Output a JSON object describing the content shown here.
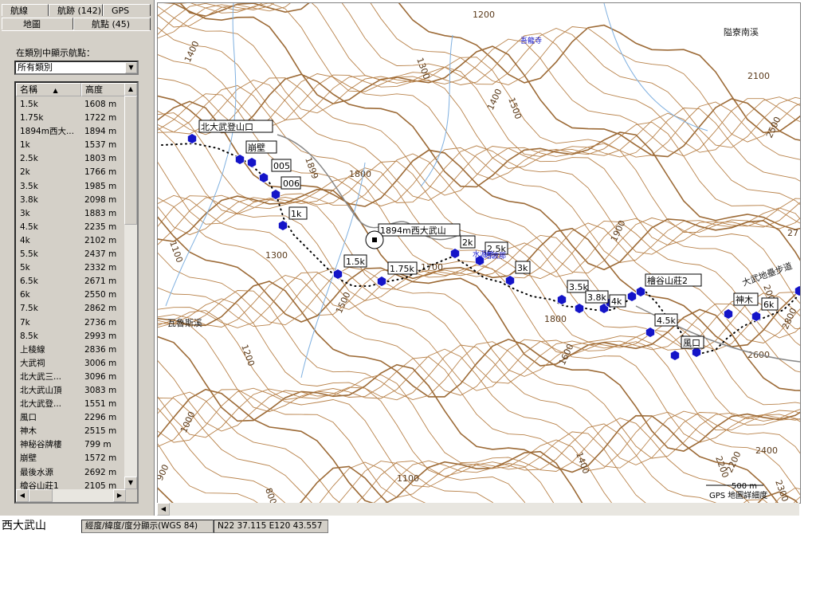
{
  "tabs_top": [
    "航線",
    "航跡 (142)",
    "GPS"
  ],
  "tabs_bottom": [
    "地圖",
    "航點 (45)"
  ],
  "filter": {
    "label": "在類別中顯示航點：",
    "selected": "所有類別"
  },
  "list": {
    "columns": [
      "名稱",
      "高度"
    ],
    "rows": [
      {
        "name": "1.5k",
        "alt": "1608 m"
      },
      {
        "name": "1.75k",
        "alt": "1722 m"
      },
      {
        "name": "1894m西大...",
        "alt": "1894 m"
      },
      {
        "name": "1k",
        "alt": "1537 m"
      },
      {
        "name": "2.5k",
        "alt": "1803 m"
      },
      {
        "name": "2k",
        "alt": "1766 m"
      },
      {
        "name": "3.5k",
        "alt": "1985 m"
      },
      {
        "name": "3.8k",
        "alt": "2098 m"
      },
      {
        "name": "3k",
        "alt": "1883 m"
      },
      {
        "name": "4.5k",
        "alt": "2235 m"
      },
      {
        "name": "4k",
        "alt": "2102 m"
      },
      {
        "name": "5.5k",
        "alt": "2437 m"
      },
      {
        "name": "5k",
        "alt": "2332 m"
      },
      {
        "name": "6.5k",
        "alt": "2671 m"
      },
      {
        "name": "6k",
        "alt": "2550 m"
      },
      {
        "name": "7.5k",
        "alt": "2862 m"
      },
      {
        "name": "7k",
        "alt": "2736 m"
      },
      {
        "name": "8.5k",
        "alt": "2993 m"
      },
      {
        "name": "上稜線",
        "alt": "2836 m"
      },
      {
        "name": "大武祠",
        "alt": "3006 m"
      },
      {
        "name": "北大武三...",
        "alt": "3096 m"
      },
      {
        "name": "北大武山頂",
        "alt": "3083 m"
      },
      {
        "name": "北大武登...",
        "alt": "1551 m"
      },
      {
        "name": "風口",
        "alt": "2296 m"
      },
      {
        "name": "神木",
        "alt": "2515 m"
      },
      {
        "name": "神秘谷牌樓",
        "alt": "799 m"
      },
      {
        "name": "崩壁",
        "alt": "1572 m"
      },
      {
        "name": "最後水源",
        "alt": "2692 m"
      },
      {
        "name": "檜谷山莊1",
        "alt": "2105 m"
      }
    ]
  },
  "map": {
    "waypoint_labels": [
      {
        "text": "北大武登山口"
      },
      {
        "text": "崩壁"
      },
      {
        "text": "005"
      },
      {
        "text": "006"
      },
      {
        "text": "1k"
      },
      {
        "text": "1.5k"
      },
      {
        "text": "1.75k"
      },
      {
        "text": "1894m西大武山"
      },
      {
        "text": "2k"
      },
      {
        "text": "2.5k"
      },
      {
        "text": "3k"
      },
      {
        "text": "3.5k"
      },
      {
        "text": "3.8k"
      },
      {
        "text": "4k"
      },
      {
        "text": "檜谷山莊2"
      },
      {
        "text": "4.5k"
      },
      {
        "text": "風口"
      },
      {
        "text": "神木"
      },
      {
        "text": "6k"
      }
    ],
    "contour_labels": [
      "1400",
      "1300",
      "1200",
      "1400",
      "1500",
      "2100",
      "2500",
      "1899",
      "1800",
      "1900",
      "2000",
      "1700",
      "1600",
      "1100",
      "1300",
      "1500",
      "1200",
      "1800",
      "1000",
      "1400",
      "1100",
      "900",
      "800",
      "2600",
      "2800",
      "2200",
      "2400",
      "2200",
      "2300",
      "27"
    ],
    "place_labels": [
      "隘寮南溪",
      "瓦魯斯溪",
      "大武地壘步道",
      "吾龍寺",
      "塔波那",
      "水源地"
    ],
    "scale": {
      "distance": "500 m",
      "detail": "GPS 地圖詳細度"
    }
  },
  "status": {
    "selected_name": "西大武山",
    "coord_format": "經度/緯度/度分顯示(WGS 84)",
    "coordinates": "N22 37.115 E120 43.557"
  },
  "colors": {
    "contour": "#b8824a",
    "contour_index": "#9c6a36",
    "waypoint": "#1414c8",
    "river": "#7fb0e0",
    "road": "#888888"
  }
}
